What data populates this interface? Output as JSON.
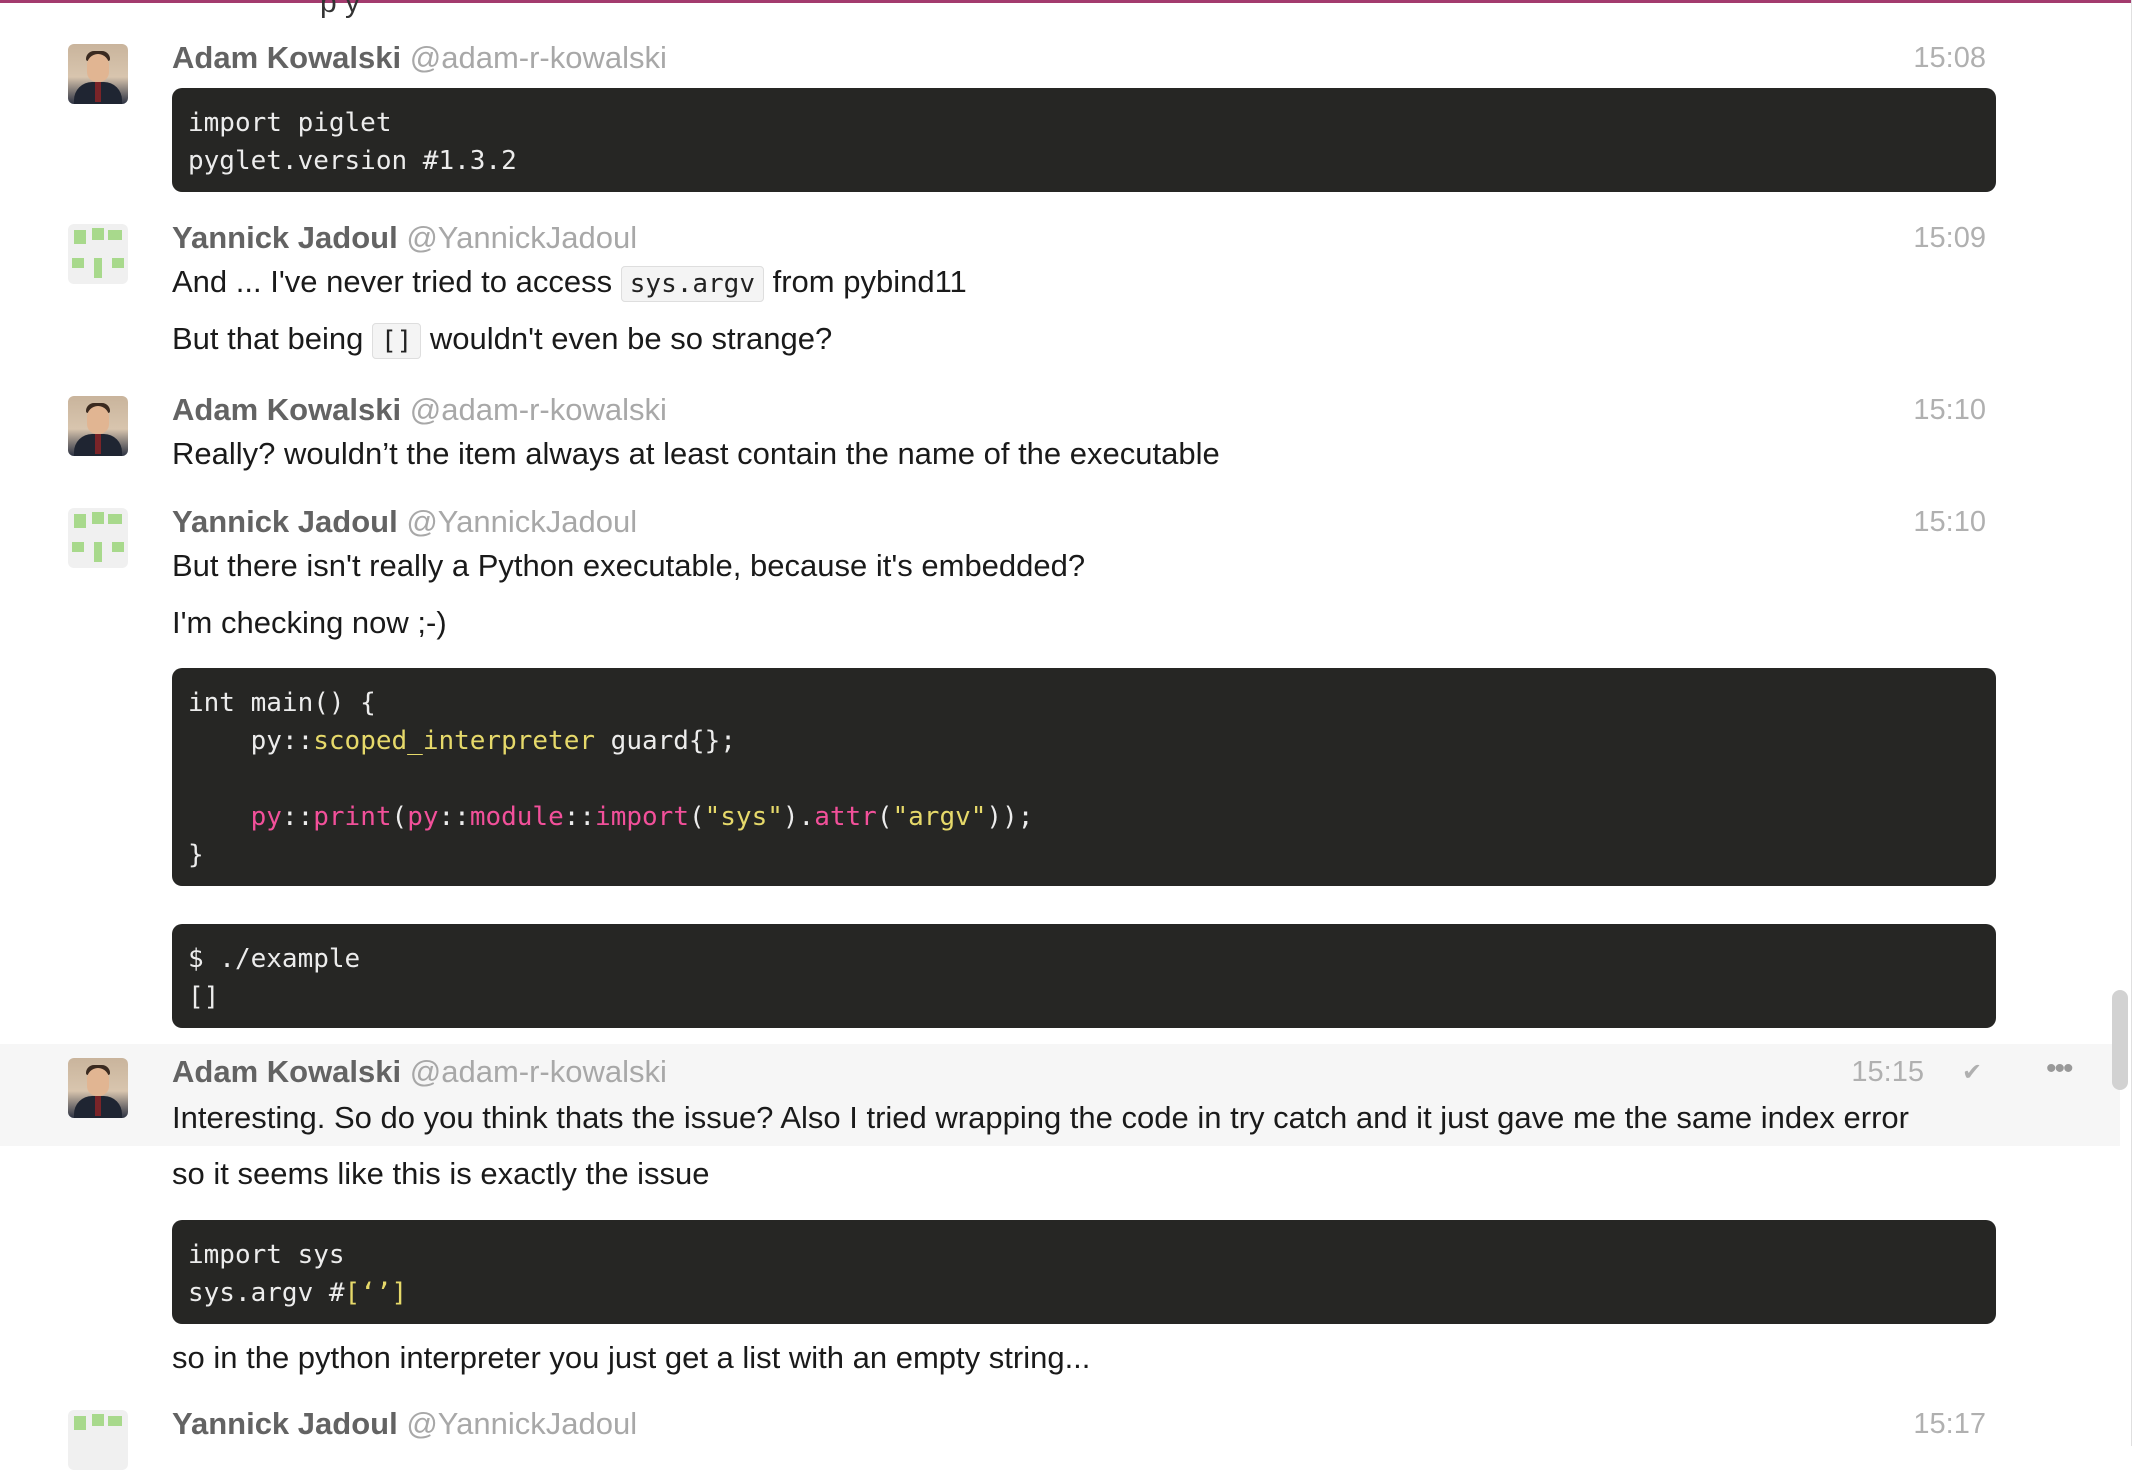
{
  "messages": [
    {
      "user": "Adam Kowalski",
      "handle": "@adam-r-kowalski",
      "time": "15:08",
      "code": [
        "import piglet",
        "pyglet.version #1.3.2"
      ]
    },
    {
      "user": "Yannick Jadoul",
      "handle": "@YannickJadoul",
      "time": "15:09",
      "line1_a": "And ... I've never tried to access",
      "line1_code": "sys.argv",
      "line1_b": "from pybind11",
      "line2_a": "But that being",
      "line2_code": "[]",
      "line2_b": "wouldn't even be so strange?"
    },
    {
      "user": "Adam Kowalski",
      "handle": "@adam-r-kowalski",
      "time": "15:10",
      "text": "Really? wouldn’t the item always at least contain the name of the executable"
    },
    {
      "user": "Yannick Jadoul",
      "handle": "@YannickJadoul",
      "time": "15:10",
      "text1": "But there isn't really a Python executable, because it's embedded?",
      "text2": "I'm checking now ;-)",
      "code1": {
        "l1": "int main() {",
        "l2_a": "py",
        "l2_b": "::",
        "l2_c": "scoped_interpreter",
        "l2_d": " guard{};",
        "l4_a": "py",
        "l4_b": "::",
        "l4_c": "print",
        "l4_d": "(",
        "l4_e": "py",
        "l4_f": "::",
        "l4_g": "module",
        "l4_h": "::",
        "l4_i": "import",
        "l4_j": "(",
        "l4_k": "\"sys\"",
        "l4_l": ").",
        "l4_m": "attr",
        "l4_n": "(",
        "l4_o": "\"argv\"",
        "l4_p": "));",
        "l5": "}"
      },
      "code2": [
        "$ ./example",
        "[]"
      ]
    },
    {
      "user": "Adam Kowalski",
      "handle": "@adam-r-kowalski",
      "time": "15:15",
      "text1": "Interesting. So do you think thats the issue? Also I tried wrapping the code in try catch and it just gave me the same index error",
      "text2": "so it seems like this is exactly the issue",
      "code_l1": "import sys",
      "code_l2_a": "sys.argv #",
      "code_l2_b": "[‘’]",
      "text3": "so in the python interpreter you just get a list with an empty string..."
    },
    {
      "user": "Yannick Jadoul",
      "handle": "@YannickJadoul",
      "time": "15:17"
    }
  ],
  "top_fragment": "p           y",
  "icons": {
    "check": "✔",
    "more": "•••"
  },
  "colors": {
    "accent_line": "#a33b6e",
    "code_bg": "#262624",
    "keyword_yellow": "#e6d96a",
    "keyword_pink": "#f2509a"
  }
}
